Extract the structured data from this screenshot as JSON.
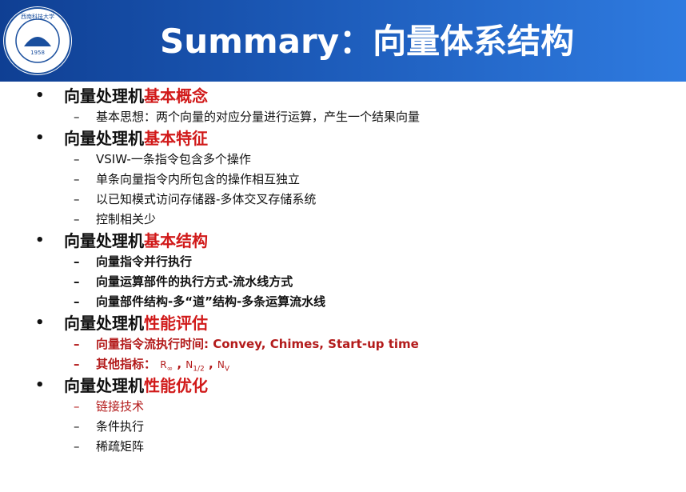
{
  "header": {
    "title": "Summary：向量体系结构",
    "logo_text": "西南科技大学",
    "logo_year": "1958"
  },
  "sections": [
    {
      "prefix": "向量处理机",
      "highlight": "基本概念",
      "items": [
        "基本思想：两个向量的对应分量进行运算，产生一个结果向量"
      ]
    },
    {
      "prefix": "向量处理机",
      "highlight": "基本特征",
      "items": [
        "VSIW-一条指令包含多个操作",
        "单条向量指令内所包含的操作相互独立",
        "以已知模式访问存储器-多体交叉存储系统",
        "控制相关少"
      ]
    },
    {
      "prefix": "向量处理机",
      "highlight": "基本结构",
      "items": [
        "向量指令并行执行",
        "向量运算部件的执行方式-流水线方式",
        "向量部件结构-多“道”结构-多条运算流水线"
      ]
    },
    {
      "prefix": "向量处理机",
      "highlight": "性能评估",
      "items": [
        "向量指令流执行时间: Convey, Chimes, Start-up time"
      ],
      "metrics": {
        "label": "其他指标：",
        "r": "R",
        "r_sub": "∞",
        "n": "N",
        "n_sub": "1/2",
        "nv": "N",
        "nv_sub": "V",
        "sep": ","
      }
    },
    {
      "prefix": "向量处理机",
      "highlight": "性能优化",
      "items": [
        "链接技术",
        "条件执行",
        "稀疏矩阵"
      ]
    }
  ],
  "bullet": "•",
  "dash": "–",
  "colors": {
    "highlight": "#d11a1a",
    "accent_text": "#b31b1b",
    "header": "#1c5ab8"
  }
}
